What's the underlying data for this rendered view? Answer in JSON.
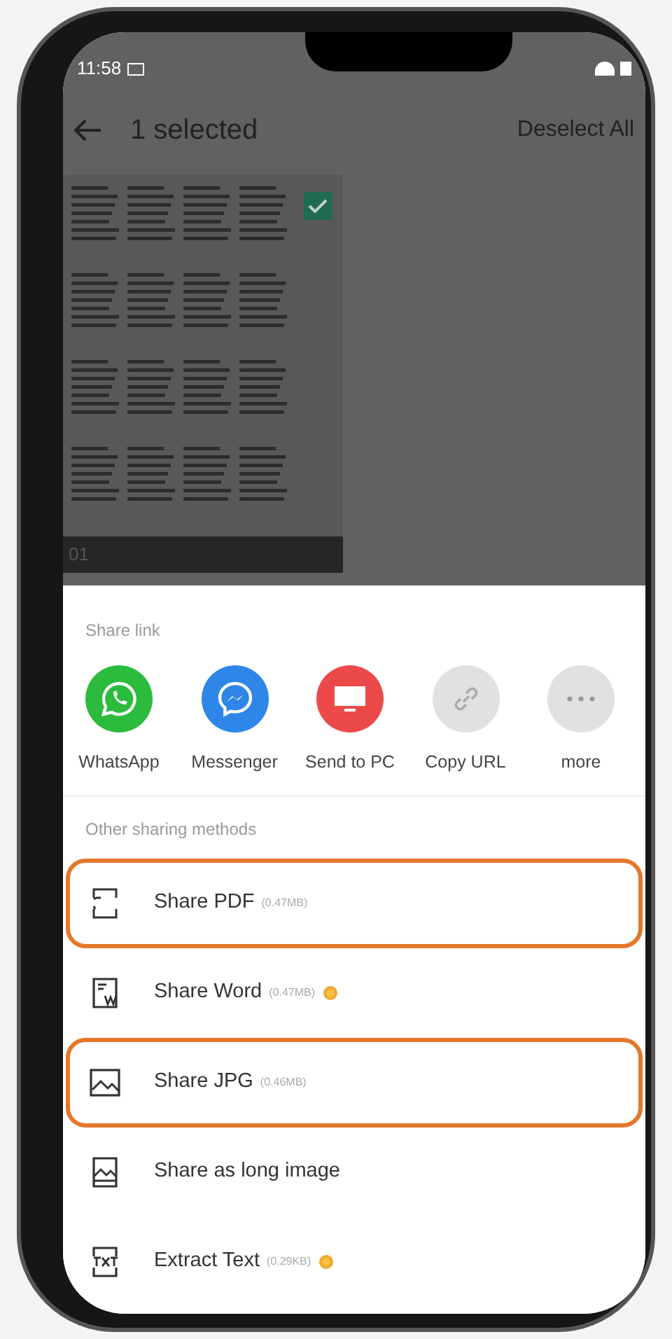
{
  "status_bar": {
    "time": "11:58"
  },
  "header": {
    "title": "1 selected",
    "action": "Deselect All"
  },
  "pages": [
    {
      "label": "01",
      "selected": true
    }
  ],
  "share_link": {
    "label": "Share link",
    "apps": [
      {
        "name": "WhatsApp",
        "kind": "whatsapp"
      },
      {
        "name": "Messenger",
        "kind": "messenger"
      },
      {
        "name": "Send to PC",
        "kind": "pc"
      },
      {
        "name": "Copy URL",
        "kind": "link"
      },
      {
        "name": "more",
        "kind": "more"
      }
    ]
  },
  "other_methods": {
    "label": "Other sharing methods",
    "items": [
      {
        "label": "Share PDF",
        "size": "(0.47MB)",
        "kind": "pdf",
        "premium": false,
        "highlighted": true
      },
      {
        "label": "Share Word",
        "size": "(0.47MB)",
        "kind": "word",
        "premium": true,
        "highlighted": false
      },
      {
        "label": "Share JPG",
        "size": "(0.46MB)",
        "kind": "jpg",
        "premium": false,
        "highlighted": true
      },
      {
        "label": "Share as long image",
        "kind": "long",
        "premium": false,
        "highlighted": false
      },
      {
        "label": "Extract Text",
        "size": "(0.29KB)",
        "kind": "txt",
        "premium": true,
        "highlighted": false
      }
    ]
  }
}
